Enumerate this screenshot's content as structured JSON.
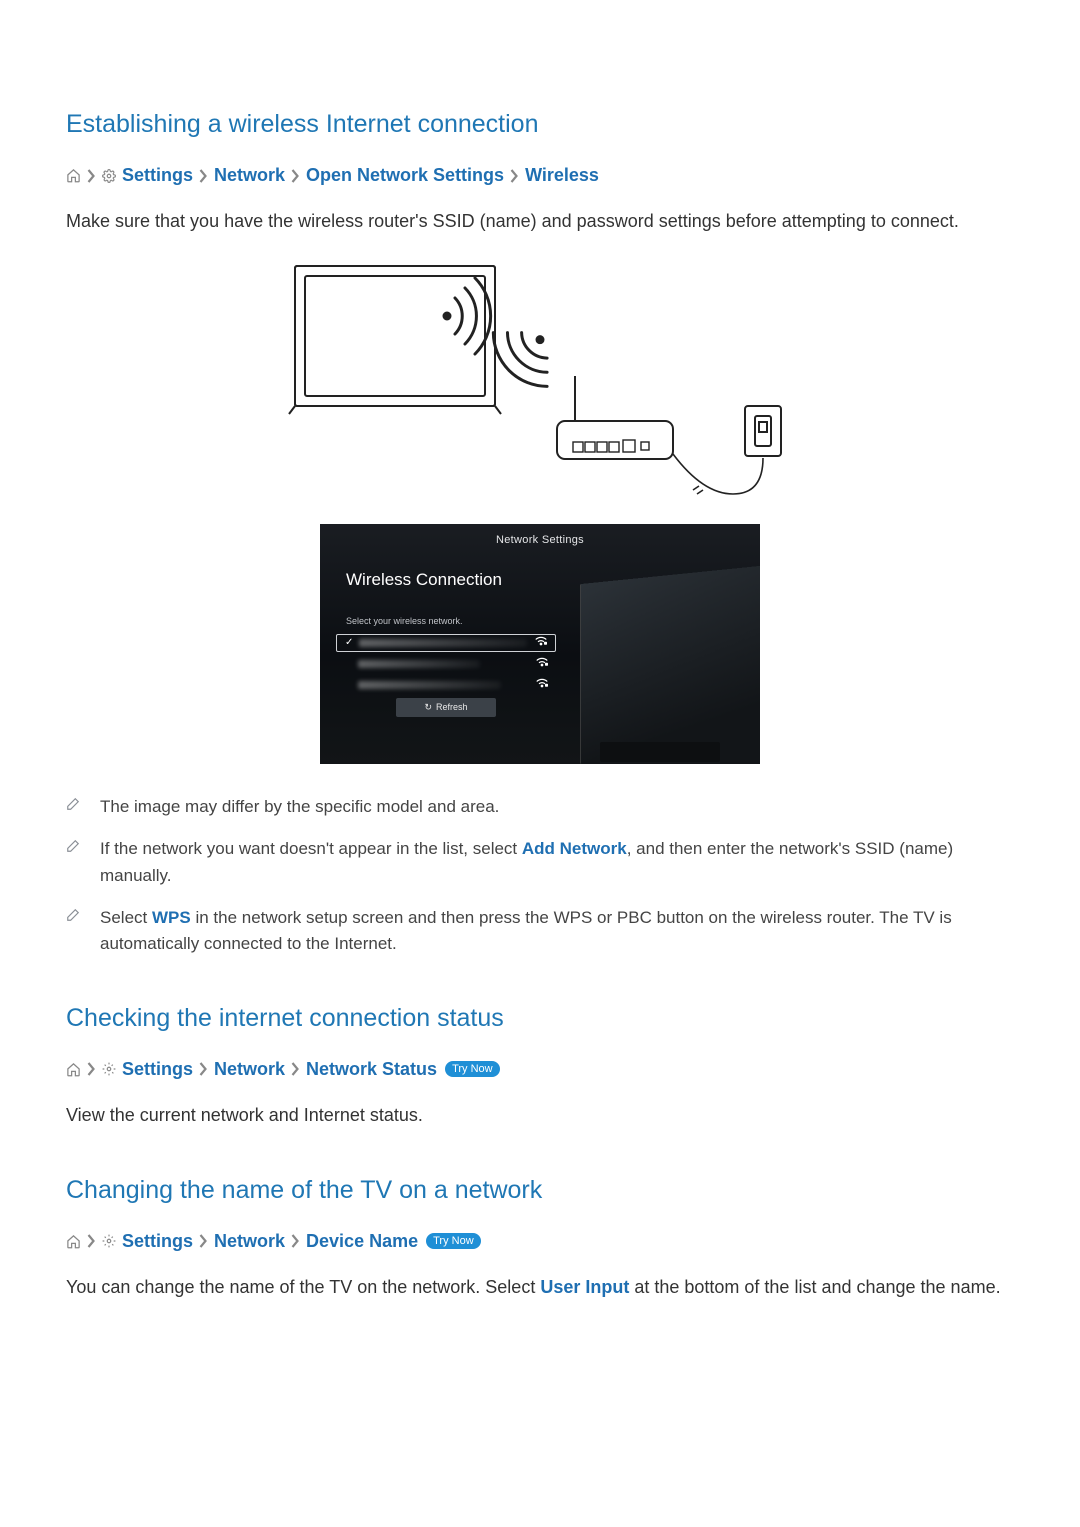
{
  "section1": {
    "heading": "Establishing a wireless Internet connection",
    "breadcrumb": {
      "settings": "Settings",
      "network": "Network",
      "open_settings": "Open Network Settings",
      "wireless": "Wireless"
    },
    "body": "Make sure that you have the wireless router's SSID (name) and password settings before attempting to connect."
  },
  "network_ui": {
    "title": "Network Settings",
    "panel_heading": "Wireless Connection",
    "hint": "Select your wireless network.",
    "refresh_label": "Refresh"
  },
  "notes": {
    "n1": "The image may differ by the specific model and area.",
    "n2_a": "If the network you want doesn't appear in the list, select ",
    "n2_link": "Add Network",
    "n2_b": ", and then enter the network's SSID (name) manually.",
    "n3_a": "Select ",
    "n3_link": "WPS",
    "n3_b": " in the network setup screen and then press the WPS or PBC button on the wireless router. The TV is automatically connected to the Internet."
  },
  "section2": {
    "heading": "Checking the internet connection status",
    "breadcrumb": {
      "settings": "Settings",
      "network": "Network",
      "status": "Network Status",
      "try": "Try Now"
    },
    "body": "View the current network and Internet status."
  },
  "section3": {
    "heading": "Changing the name of the TV on a network",
    "breadcrumb": {
      "settings": "Settings",
      "network": "Network",
      "device": "Device Name",
      "try": "Try Now"
    },
    "body_a": "You can change the name of the TV on the network. Select ",
    "body_link": "User Input",
    "body_b": " at the bottom of the list and change the name."
  }
}
